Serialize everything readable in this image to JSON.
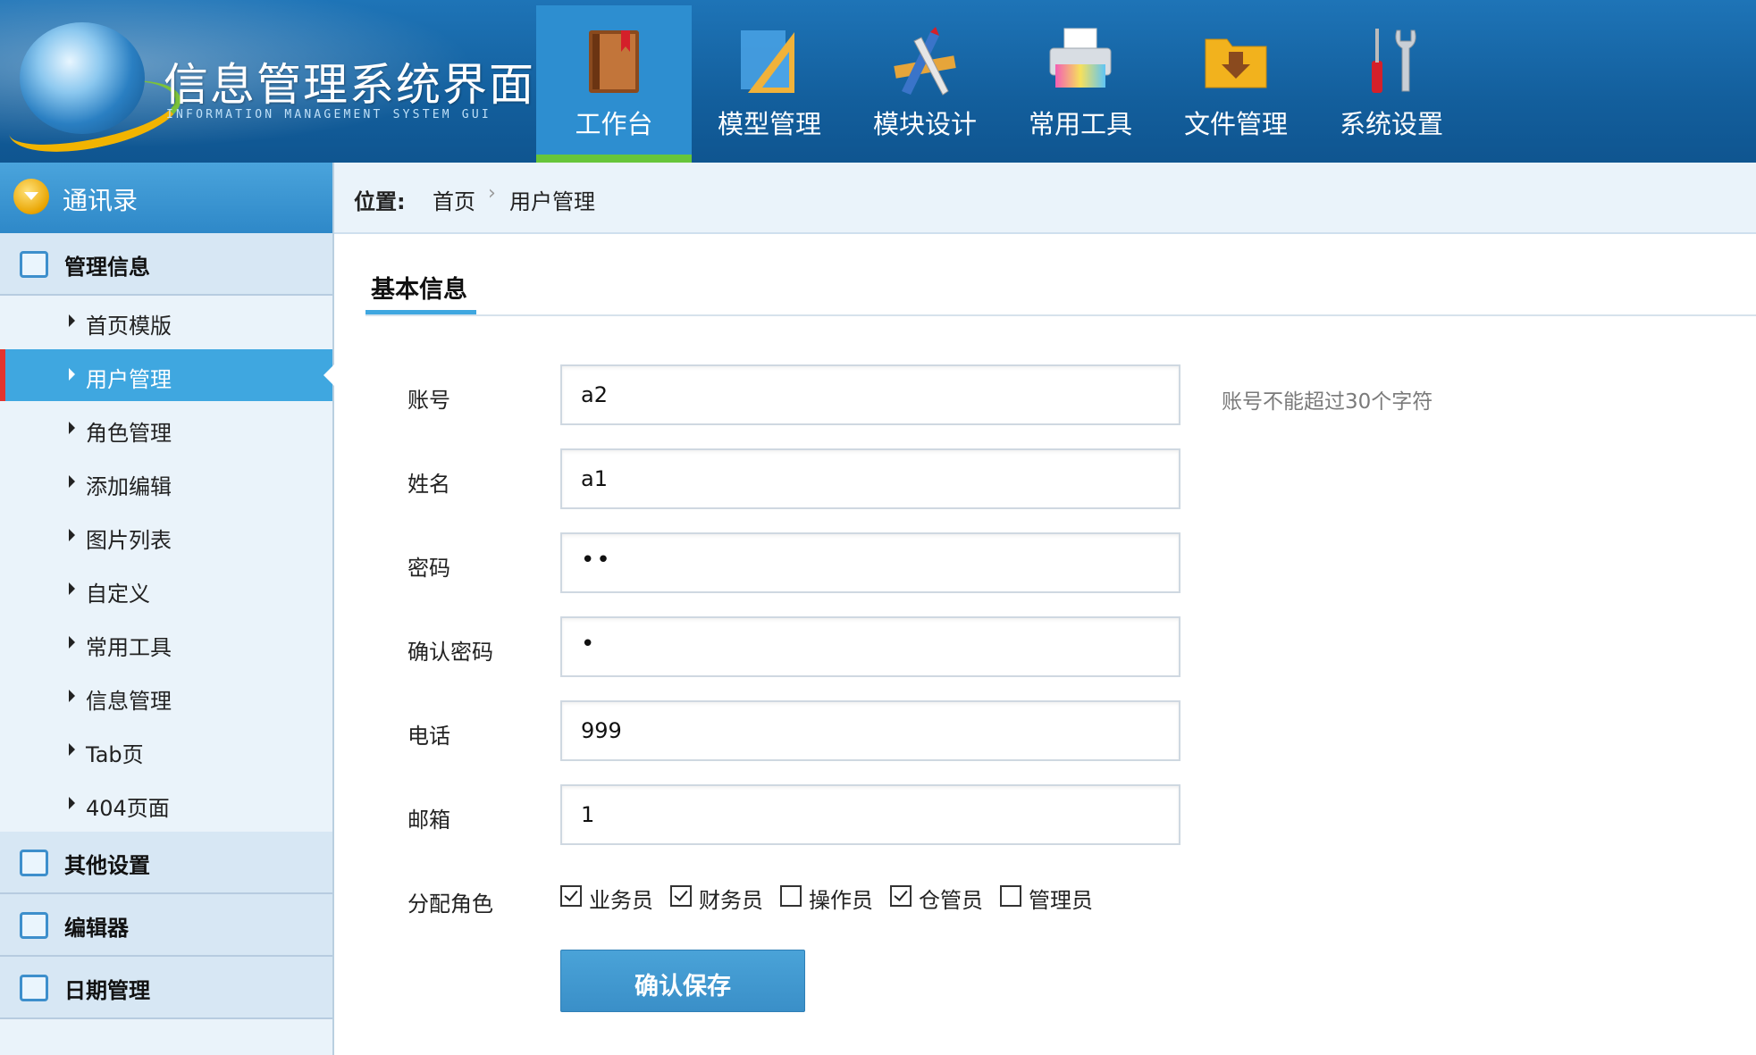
{
  "header": {
    "title": "信息管理系统界面",
    "subtitle": "INFORMATION MANAGEMENT SYSTEM GUI",
    "nav": [
      {
        "label": "工作台",
        "icon": "book-icon",
        "active": true
      },
      {
        "label": "模型管理",
        "icon": "triangle-ruler-icon"
      },
      {
        "label": "模块设计",
        "icon": "pencil-ruler-icon"
      },
      {
        "label": "常用工具",
        "icon": "printer-icon"
      },
      {
        "label": "文件管理",
        "icon": "folder-download-icon"
      },
      {
        "label": "系统设置",
        "icon": "tools-icon"
      }
    ]
  },
  "sidebar": {
    "top": {
      "label": "通讯录",
      "icon": "circle-arrow-icon"
    },
    "sections": [
      {
        "label": "管理信息",
        "icon": "list-icon"
      },
      {
        "label": "其他设置",
        "icon": "chat-icon"
      },
      {
        "label": "编辑器",
        "icon": "edit-icon"
      },
      {
        "label": "日期管理",
        "icon": "calendar-icon"
      }
    ],
    "items": [
      {
        "label": "首页模版"
      },
      {
        "label": "用户管理",
        "active": true
      },
      {
        "label": "角色管理"
      },
      {
        "label": "添加编辑"
      },
      {
        "label": "图片列表"
      },
      {
        "label": "自定义"
      },
      {
        "label": "常用工具"
      },
      {
        "label": "信息管理"
      },
      {
        "label": "Tab页"
      },
      {
        "label": "404页面"
      }
    ]
  },
  "breadcrumb": {
    "prefix": "位置:",
    "home": "首页",
    "separator": "›",
    "current": "用户管理"
  },
  "tab": {
    "label": "基本信息"
  },
  "form": {
    "fields": [
      {
        "label": "账号",
        "value": "a2"
      },
      {
        "label": "姓名",
        "value": "a1"
      },
      {
        "label": "密码",
        "value": "••"
      },
      {
        "label": "确认密码",
        "value": "•"
      },
      {
        "label": "电话",
        "value": "999"
      },
      {
        "label": "邮箱",
        "value": "1"
      }
    ],
    "account_hint": "账号不能超过30个字符",
    "roles_label": "分配角色",
    "roles": [
      {
        "label": "业务员",
        "checked": true
      },
      {
        "label": "财务员",
        "checked": true
      },
      {
        "label": "操作员",
        "checked": false
      },
      {
        "label": "仓管员",
        "checked": true
      },
      {
        "label": "管理员",
        "checked": false
      }
    ],
    "save_label": "确认保存"
  },
  "colors": {
    "header_bg": "#135f9d",
    "active_blue": "#3fa7e0",
    "active_green": "#67c53a",
    "active_red": "#e3342f"
  }
}
